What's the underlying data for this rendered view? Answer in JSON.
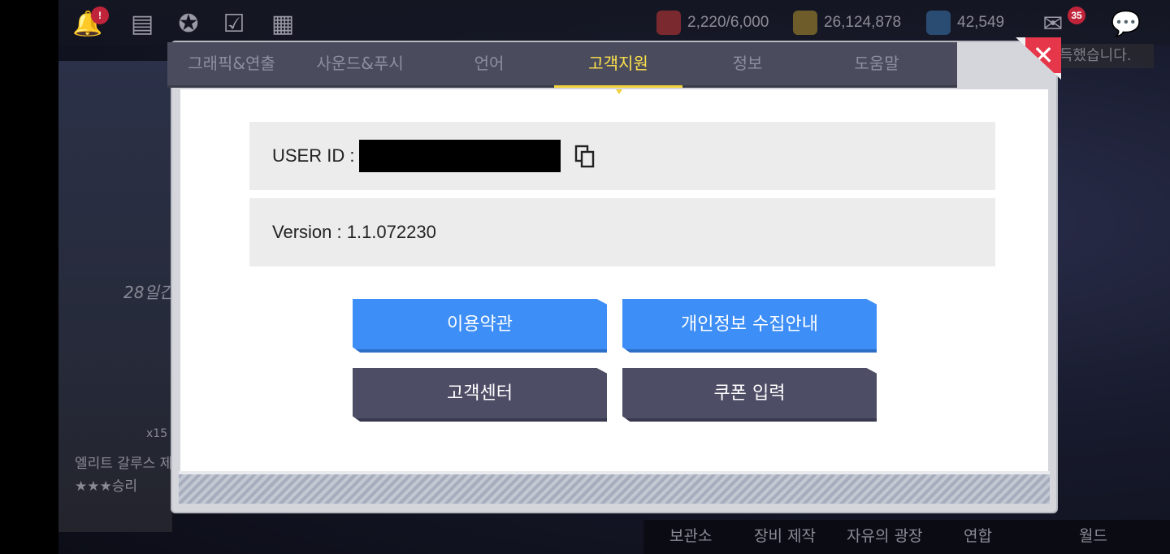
{
  "background": {
    "resources": [
      {
        "name": "stamina",
        "value": "2,220/6,000",
        "color": "#c9343a"
      },
      {
        "name": "gold",
        "value": "26,124,878",
        "color": "#c8a640"
      },
      {
        "name": "crystal",
        "value": "42,549",
        "color": "#3d7bd6"
      }
    ],
    "mail_badge": "35",
    "notice_partial": "득했습니다.",
    "side_labels": [
      "28일간",
      "엘리트 갈루스 제",
      "★★★승리",
      "x15"
    ],
    "bottom_menu": [
      "보관소",
      "장비 제작",
      "자유의 광장",
      "연합",
      "월드"
    ]
  },
  "dialog": {
    "tabs": [
      {
        "label": "그래픽&연출",
        "active": false
      },
      {
        "label": "사운드&푸시",
        "active": false
      },
      {
        "label": "언어",
        "active": false
      },
      {
        "label": "고객지원",
        "active": true
      },
      {
        "label": "정보",
        "active": false
      },
      {
        "label": "도움말",
        "active": false
      }
    ],
    "close_label": "✕",
    "user_id_label": "USER ID :",
    "version_text": "Version : 1.1.072230",
    "buttons": {
      "terms": "이용약관",
      "privacy": "개인정보 수집안내",
      "support_center": "고객센터",
      "coupon": "쿠폰 입력"
    }
  },
  "colors": {
    "active_tab": "#ffe24b",
    "blue_button": "#3d8ef6",
    "dark_button": "#4d4d66",
    "close_red": "#e6374a"
  }
}
